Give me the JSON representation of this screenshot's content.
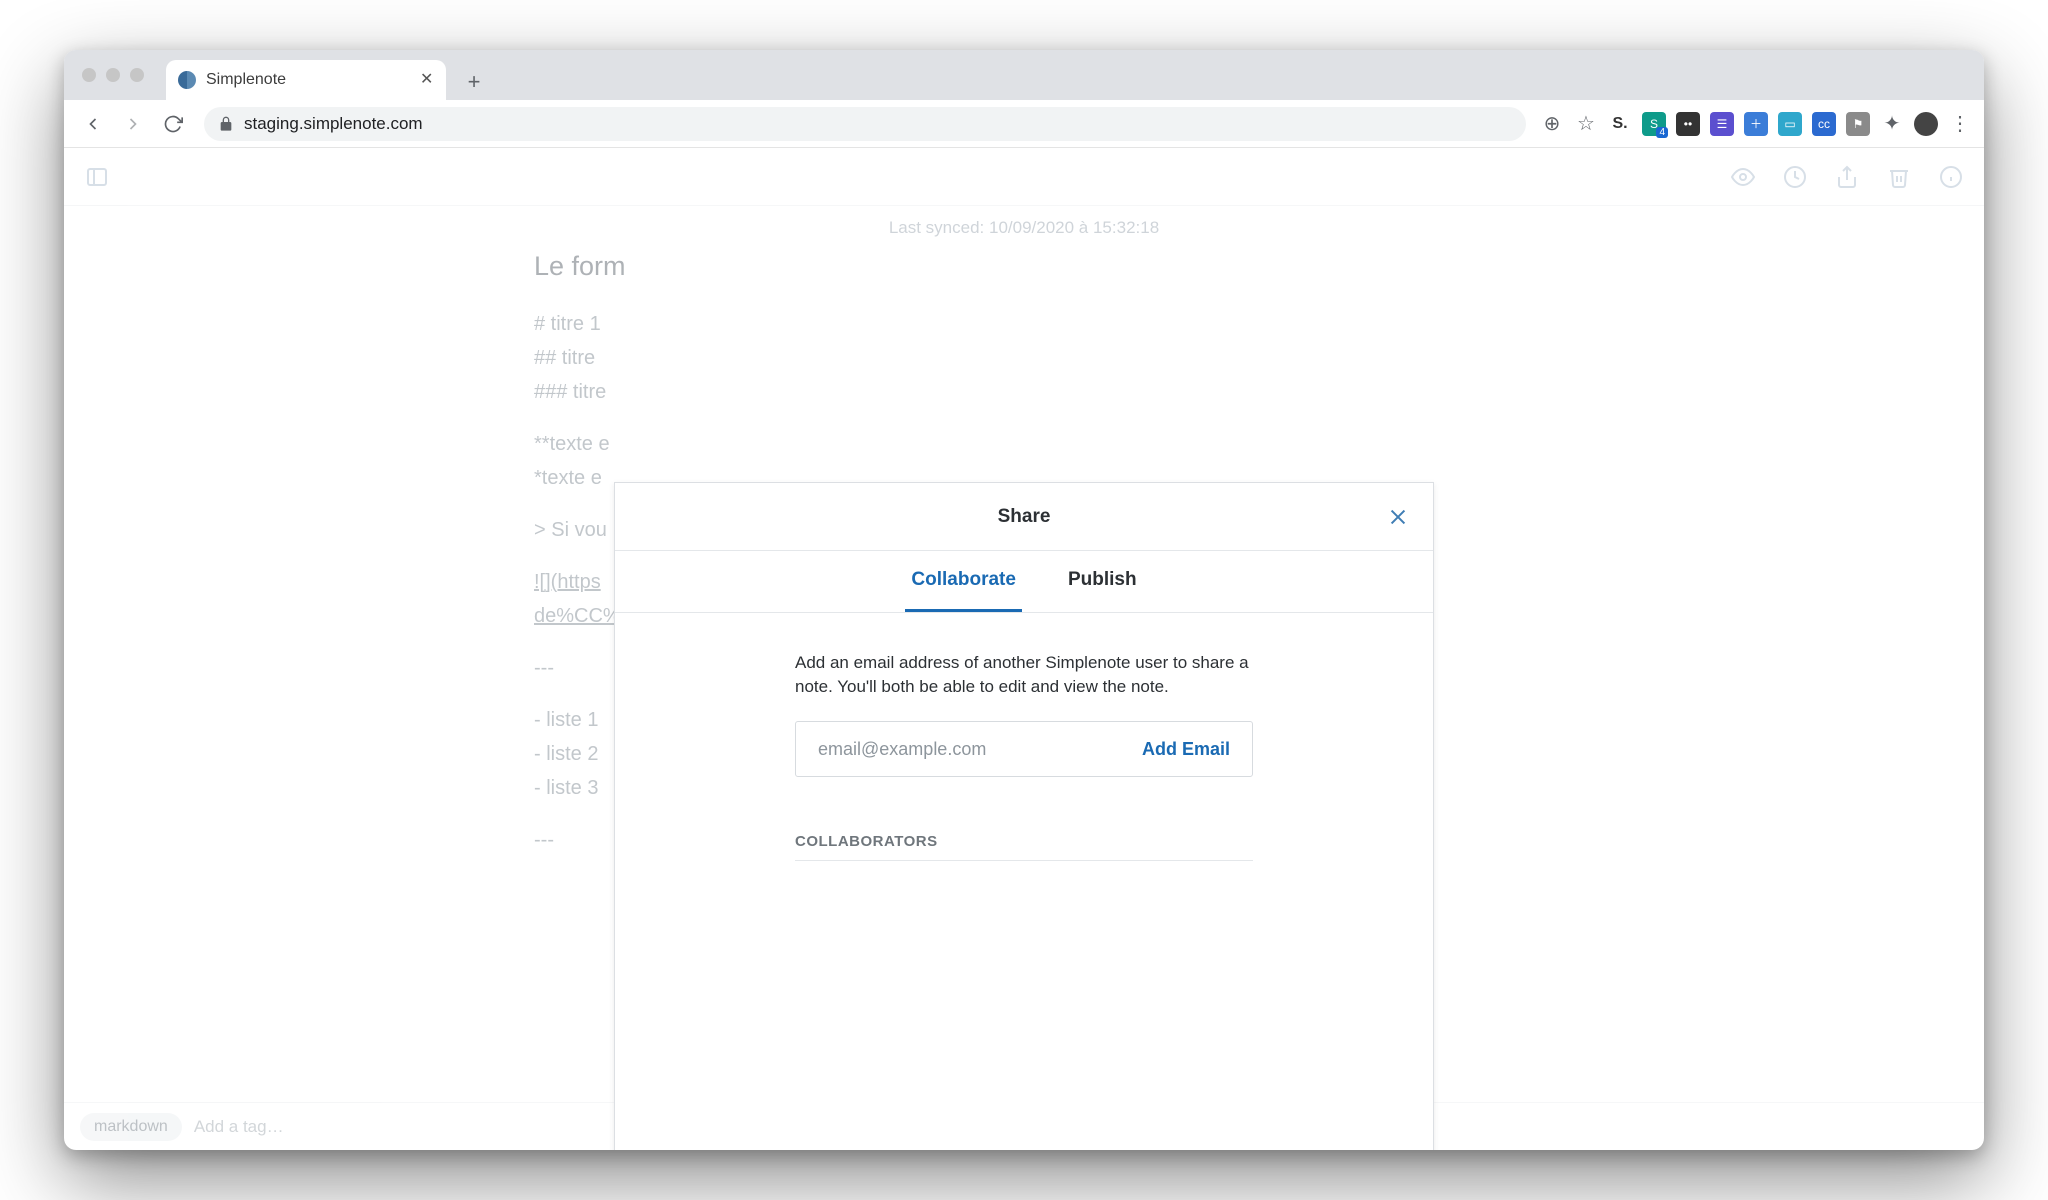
{
  "browser": {
    "tab_title": "Simplenote",
    "url": "staging.simplenote.com"
  },
  "app_header": {
    "sync_status": "Last synced: 10/09/2020 à 15:32:18"
  },
  "note": {
    "title": "Le form",
    "lines": {
      "l1": "# titre 1",
      "l2": "## titre",
      "l3": "### titre",
      "l4": "**texte e",
      "l5": "*texte e",
      "l6": "> Si vou",
      "l7": "![](https",
      "l8": "de%CC%",
      "l9": "---",
      "l10": "- liste 1",
      "l11": "- liste 2",
      "l12": "- liste 3",
      "l13": "---"
    }
  },
  "tagbar": {
    "tag1": "markdown",
    "add_placeholder": "Add a tag…"
  },
  "modal": {
    "title": "Share",
    "tabs": {
      "collaborate": "Collaborate",
      "publish": "Publish"
    },
    "description": "Add an email address of another Simplenote user to share a note. You'll both be able to edit and view the note.",
    "email_placeholder": "email@example.com",
    "add_email_label": "Add Email",
    "collaborators_heading": "COLLABORATORS"
  }
}
